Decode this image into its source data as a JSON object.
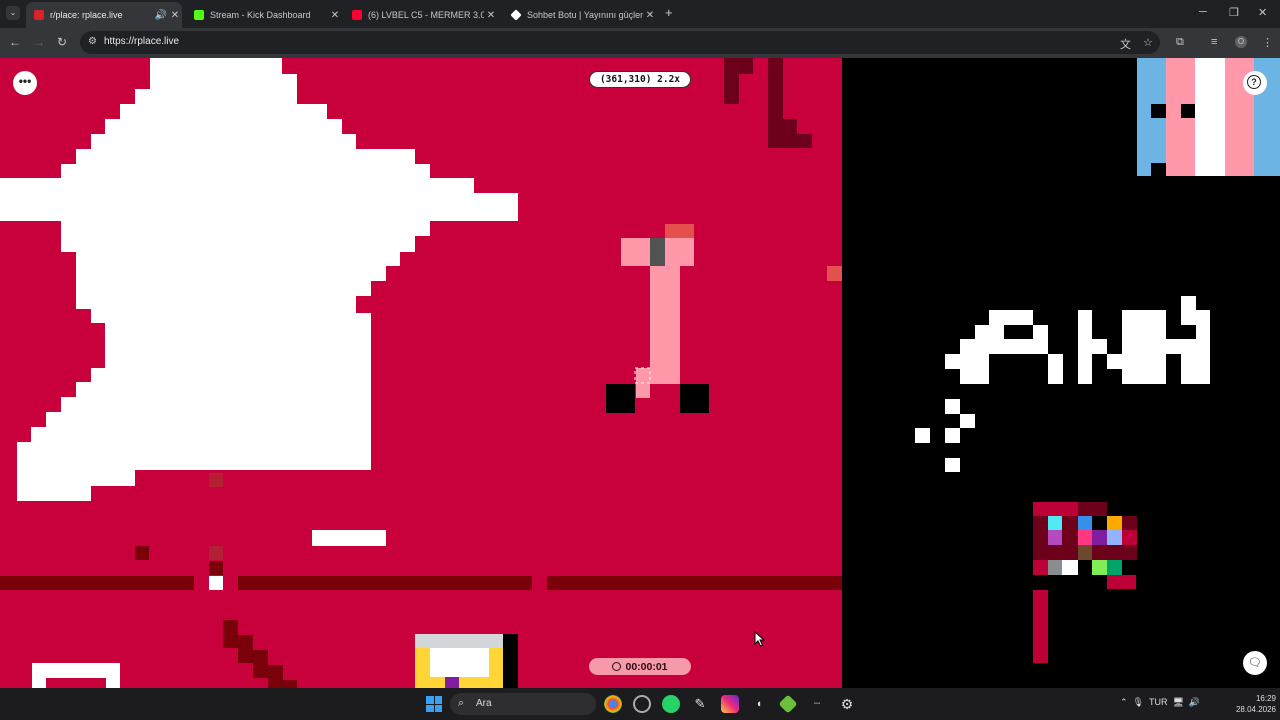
{
  "browser": {
    "tabs": [
      {
        "title": "r/place: rplace.live",
        "active": true,
        "favicon_color": "#d9222a",
        "audio": true
      },
      {
        "title": "Stream - Kick Dashboard",
        "active": false,
        "favicon_color": "#53fc18"
      },
      {
        "title": "(6) LVBEL C5 - MERMER 3.0 (M",
        "active": false,
        "favicon_color": "#ff0033"
      },
      {
        "title": "Sohbet Botu | Yayınını güçlend",
        "active": false,
        "favicon_color": "#ffffff"
      }
    ],
    "new_tab_icon": "plus-icon",
    "url": "https://rplace.live"
  },
  "canvas_ui": {
    "coordinates": "(361,310) 2.2x",
    "timer": "00:00:01",
    "menu_icon": "more-dots-icon",
    "help_icon": "help-circle-icon",
    "chat_icon": "chat-bubble-icon"
  },
  "palette": {
    "bg": "#000000",
    "crimson": "#c8003c",
    "dark_red": "#7a0009",
    "maroon": "#6d001a",
    "pink": "#ff99aa",
    "gray": "#515252",
    "white": "#ffffff",
    "light_blue": "#6cb4e4",
    "red": "#be0039"
  },
  "taskbar": {
    "search_label": "Ara",
    "time": "16:29",
    "date": "28.04.2026",
    "language": "TUR"
  }
}
